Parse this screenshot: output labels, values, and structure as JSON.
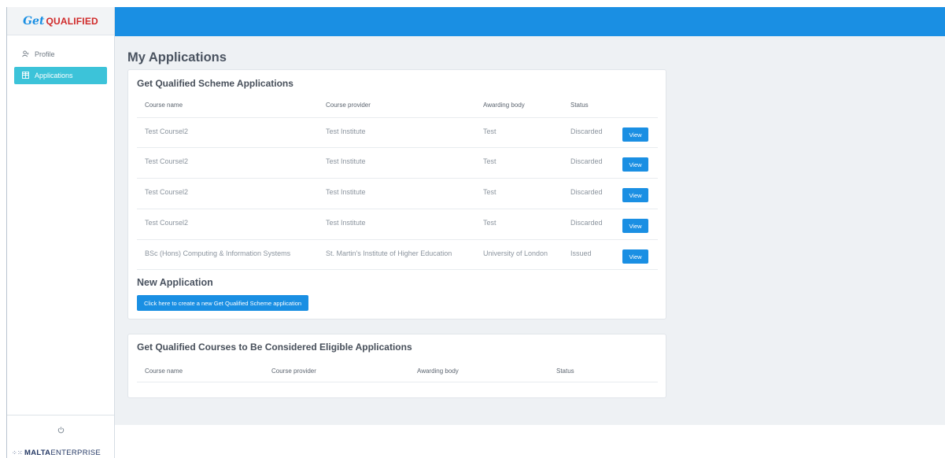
{
  "app": {
    "logo": {
      "script": "Get",
      "word": "QUALIFIED"
    },
    "footer_logo": {
      "bold": "MALTA",
      "light": "ENTERPRISE"
    }
  },
  "sidebar": {
    "items": [
      {
        "label": "Profile",
        "icon": "user-icon",
        "active": false
      },
      {
        "label": "Applications",
        "icon": "table-icon",
        "active": true
      }
    ],
    "power_icon": "power-icon"
  },
  "page": {
    "title": "My Applications"
  },
  "scheme_applications": {
    "title": "Get Qualified Scheme Applications",
    "columns": [
      "Course name",
      "Course provider",
      "Awarding body",
      "Status"
    ],
    "rows": [
      {
        "course": "Test Coursel2",
        "provider": "Test Institute",
        "body": "Test",
        "status": "Discarded",
        "action": "View"
      },
      {
        "course": "Test Coursel2",
        "provider": "Test Institute",
        "body": "Test",
        "status": "Discarded",
        "action": "View"
      },
      {
        "course": "Test Coursel2",
        "provider": "Test Institute",
        "body": "Test",
        "status": "Discarded",
        "action": "View"
      },
      {
        "course": "Test Coursel2",
        "provider": "Test Institute",
        "body": "Test",
        "status": "Discarded",
        "action": "View"
      },
      {
        "course": "BSc (Hons) Computing & Information Systems",
        "provider": "St. Martin's Institute of Higher Education",
        "body": "University of London",
        "status": "Issued",
        "action": "View"
      }
    ],
    "new_application": {
      "heading": "New Application",
      "button": "Click here to create a new Get Qualified Scheme application"
    }
  },
  "eligible_courses": {
    "title": "Get Qualified Courses to Be Considered Eligible Applications",
    "columns": [
      "Course name",
      "Course provider",
      "Awarding body",
      "Status"
    ]
  },
  "colors": {
    "primary": "#1a8fe3",
    "sidebar_active": "#3cc3d9",
    "logo_red": "#d02a2a",
    "background": "#eef1f4"
  }
}
